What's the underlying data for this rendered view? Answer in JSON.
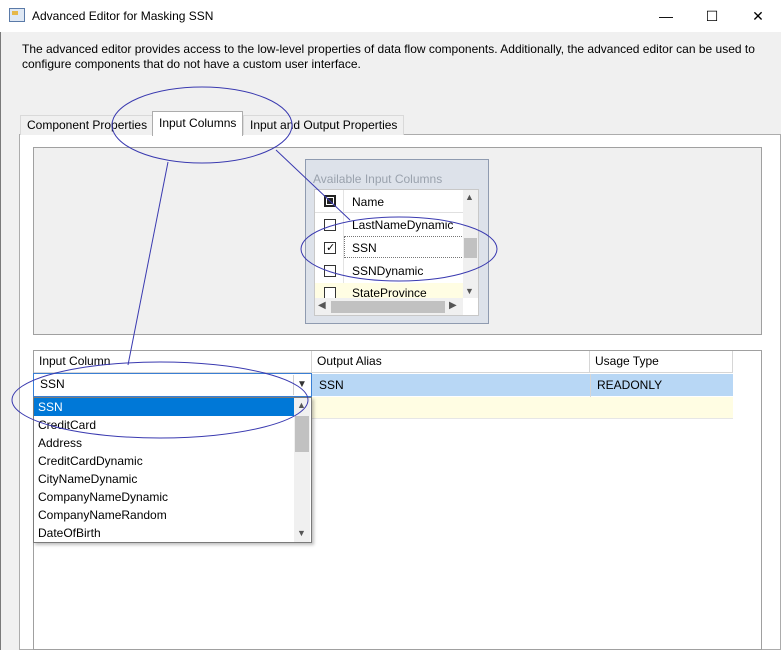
{
  "window": {
    "title": "Advanced Editor for Masking SSN",
    "controls": {
      "minimize": "—",
      "maximize": "☐",
      "close": "✕"
    }
  },
  "description": "The advanced editor provides access to the low-level properties of data flow components. Additionally, the advanced editor can be used to configure components that do not have a custom user interface.",
  "tabs": [
    {
      "label": "Component Properties"
    },
    {
      "label": "Input Columns",
      "active": true
    },
    {
      "label": "Input and Output Properties"
    }
  ],
  "available": {
    "label": "Available Input Columns",
    "header": "Name",
    "rows": [
      {
        "name": "LastNameDynamic",
        "checked": false
      },
      {
        "name": "SSN",
        "checked": true
      },
      {
        "name": "SSNDynamic",
        "checked": false
      },
      {
        "name": "StateProvince",
        "checked": false
      }
    ]
  },
  "grid": {
    "headers": [
      "Input Column",
      "Output Alias",
      "Usage Type"
    ],
    "rows": [
      {
        "input_column": "SSN",
        "output_alias": "SSN",
        "usage_type": "READONLY"
      }
    ]
  },
  "dropdown": {
    "items": [
      "SSN",
      "CreditCard",
      "Address",
      "CreditCardDynamic",
      "CityNameDynamic",
      "CompanyNameDynamic",
      "CompanyNameRandom",
      "DateOfBirth"
    ],
    "selected": "SSN"
  }
}
